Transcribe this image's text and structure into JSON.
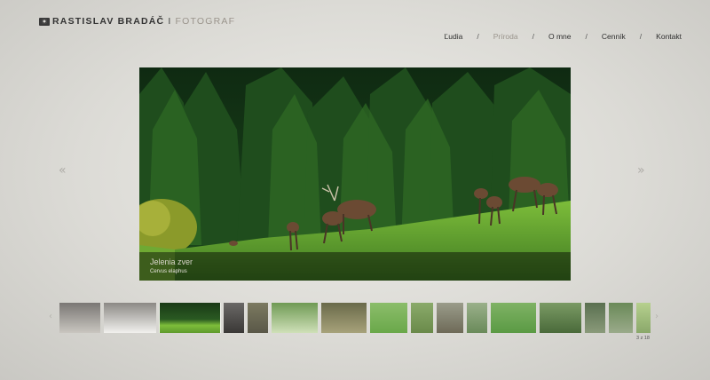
{
  "header": {
    "brand_name": "RASTISLAV BRADÁČ",
    "brand_sep": "I",
    "brand_role": "FOTOGRAF",
    "logo_icon": "camera-icon"
  },
  "nav": {
    "items": [
      {
        "label": "Ľudia",
        "active": false
      },
      {
        "label": "Príroda",
        "active": true
      },
      {
        "label": "O mne",
        "active": false
      },
      {
        "label": "Cenník",
        "active": false
      },
      {
        "label": "Kontakt",
        "active": false
      }
    ],
    "separator": "/"
  },
  "slider": {
    "prev_glyph": "«",
    "next_glyph": "»",
    "caption_title": "Jelenia zver",
    "caption_subtitle": "Cervus elaphus"
  },
  "thumbnails": {
    "prev_glyph": "‹",
    "next_glyph": "›",
    "counter": "3 z 18",
    "active_index": 2
  },
  "colors": {
    "accent": "#9a948c",
    "text": "#2f2f2f"
  }
}
